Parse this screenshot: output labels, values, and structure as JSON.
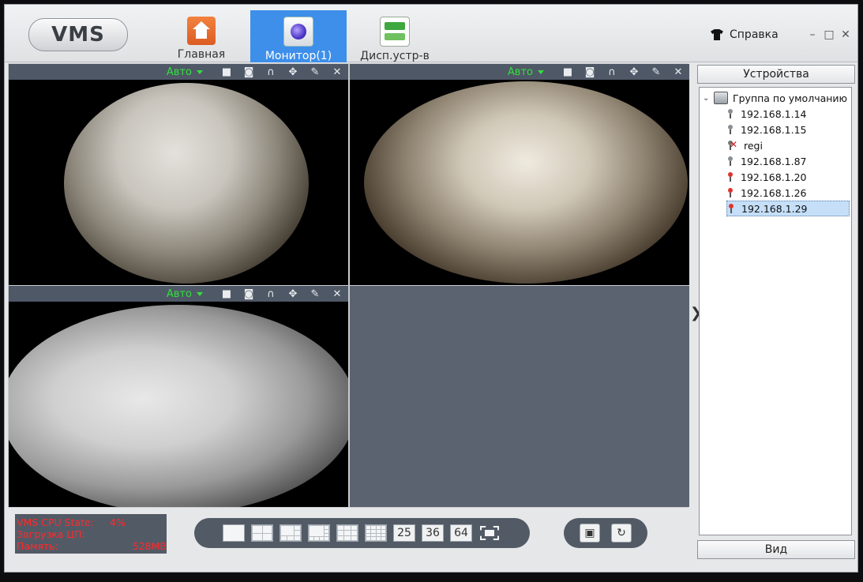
{
  "app": {
    "logo": "VMS"
  },
  "nav": [
    {
      "label": "Главная",
      "icon": "home-icon",
      "active": false
    },
    {
      "label": "Монитор(1)",
      "icon": "monitor-icon",
      "active": true
    },
    {
      "label": "Дисп.устр-в",
      "icon": "device-manager-icon",
      "active": false
    }
  ],
  "header": {
    "help_label": "Справка",
    "help_icon": "shirt-icon"
  },
  "window_controls": {
    "minimize": "–",
    "maximize": "□",
    "close": "✕"
  },
  "panes": [
    {
      "stream": "Авто"
    },
    {
      "stream": "Авто"
    },
    {
      "stream": "Авто"
    }
  ],
  "pane_toolbar_icons": [
    "record-icon",
    "snapshot-icon",
    "audio-icon",
    "ptz-icon",
    "color-adjust-icon",
    "close-icon"
  ],
  "sidebar": {
    "title": "Устройства",
    "footer": "Вид",
    "group": "Группа по умолчанию",
    "devices": [
      {
        "label": "192.168.1.14",
        "status": "online"
      },
      {
        "label": "192.168.1.15",
        "status": "online"
      },
      {
        "label": "regi",
        "status": "offline"
      },
      {
        "label": "192.168.1.87",
        "status": "online"
      },
      {
        "label": "192.168.1.20",
        "status": "alarm"
      },
      {
        "label": "192.168.1.26",
        "status": "alarm"
      },
      {
        "label": "192.168.1.29",
        "status": "alarm",
        "selected": true
      }
    ]
  },
  "stats": {
    "cpu_label": "VMS CPU State:",
    "cpu_value": "4%",
    "load_label": "Загрузка ЦП:",
    "load_value": "",
    "mem_label": "Память:",
    "mem_value": "528MB"
  },
  "layouts": {
    "n25": "25",
    "n36": "36",
    "n64": "64"
  },
  "colors": {
    "accent": "#3d8fea",
    "stream_text": "#31e03c",
    "stats_text": "#ff2a2a",
    "pane_bar": "#4f5866"
  }
}
